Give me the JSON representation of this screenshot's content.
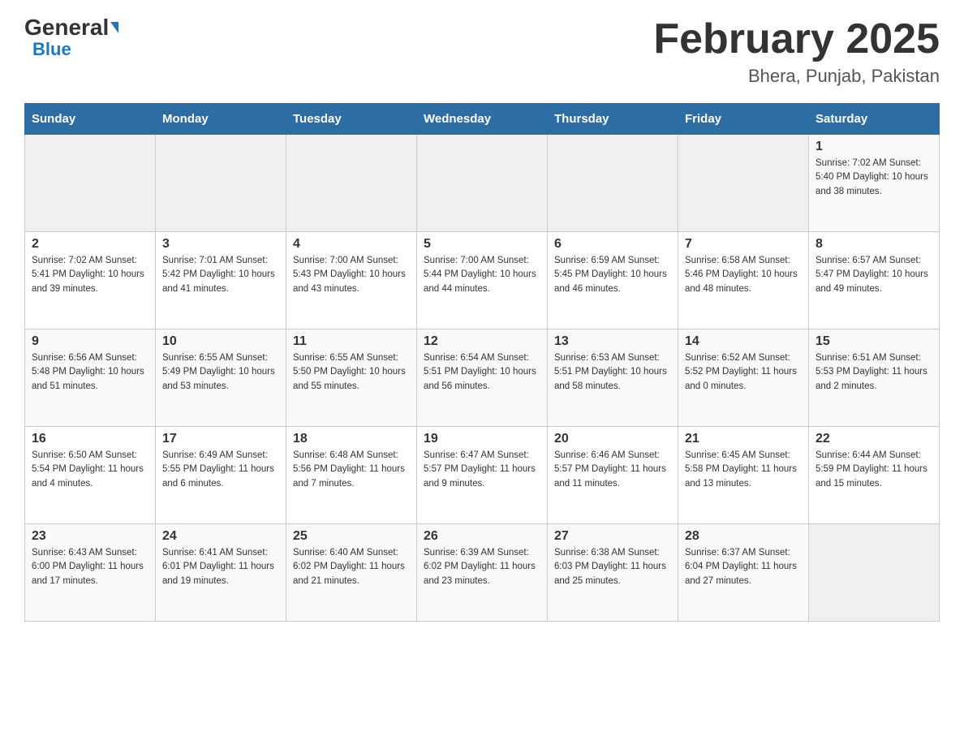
{
  "header": {
    "logo_general": "General",
    "logo_blue": "Blue",
    "month_title": "February 2025",
    "location": "Bhera, Punjab, Pakistan"
  },
  "weekdays": [
    "Sunday",
    "Monday",
    "Tuesday",
    "Wednesday",
    "Thursday",
    "Friday",
    "Saturday"
  ],
  "weeks": [
    [
      {
        "day": "",
        "info": ""
      },
      {
        "day": "",
        "info": ""
      },
      {
        "day": "",
        "info": ""
      },
      {
        "day": "",
        "info": ""
      },
      {
        "day": "",
        "info": ""
      },
      {
        "day": "",
        "info": ""
      },
      {
        "day": "1",
        "info": "Sunrise: 7:02 AM\nSunset: 5:40 PM\nDaylight: 10 hours\nand 38 minutes."
      }
    ],
    [
      {
        "day": "2",
        "info": "Sunrise: 7:02 AM\nSunset: 5:41 PM\nDaylight: 10 hours\nand 39 minutes."
      },
      {
        "day": "3",
        "info": "Sunrise: 7:01 AM\nSunset: 5:42 PM\nDaylight: 10 hours\nand 41 minutes."
      },
      {
        "day": "4",
        "info": "Sunrise: 7:00 AM\nSunset: 5:43 PM\nDaylight: 10 hours\nand 43 minutes."
      },
      {
        "day": "5",
        "info": "Sunrise: 7:00 AM\nSunset: 5:44 PM\nDaylight: 10 hours\nand 44 minutes."
      },
      {
        "day": "6",
        "info": "Sunrise: 6:59 AM\nSunset: 5:45 PM\nDaylight: 10 hours\nand 46 minutes."
      },
      {
        "day": "7",
        "info": "Sunrise: 6:58 AM\nSunset: 5:46 PM\nDaylight: 10 hours\nand 48 minutes."
      },
      {
        "day": "8",
        "info": "Sunrise: 6:57 AM\nSunset: 5:47 PM\nDaylight: 10 hours\nand 49 minutes."
      }
    ],
    [
      {
        "day": "9",
        "info": "Sunrise: 6:56 AM\nSunset: 5:48 PM\nDaylight: 10 hours\nand 51 minutes."
      },
      {
        "day": "10",
        "info": "Sunrise: 6:55 AM\nSunset: 5:49 PM\nDaylight: 10 hours\nand 53 minutes."
      },
      {
        "day": "11",
        "info": "Sunrise: 6:55 AM\nSunset: 5:50 PM\nDaylight: 10 hours\nand 55 minutes."
      },
      {
        "day": "12",
        "info": "Sunrise: 6:54 AM\nSunset: 5:51 PM\nDaylight: 10 hours\nand 56 minutes."
      },
      {
        "day": "13",
        "info": "Sunrise: 6:53 AM\nSunset: 5:51 PM\nDaylight: 10 hours\nand 58 minutes."
      },
      {
        "day": "14",
        "info": "Sunrise: 6:52 AM\nSunset: 5:52 PM\nDaylight: 11 hours\nand 0 minutes."
      },
      {
        "day": "15",
        "info": "Sunrise: 6:51 AM\nSunset: 5:53 PM\nDaylight: 11 hours\nand 2 minutes."
      }
    ],
    [
      {
        "day": "16",
        "info": "Sunrise: 6:50 AM\nSunset: 5:54 PM\nDaylight: 11 hours\nand 4 minutes."
      },
      {
        "day": "17",
        "info": "Sunrise: 6:49 AM\nSunset: 5:55 PM\nDaylight: 11 hours\nand 6 minutes."
      },
      {
        "day": "18",
        "info": "Sunrise: 6:48 AM\nSunset: 5:56 PM\nDaylight: 11 hours\nand 7 minutes."
      },
      {
        "day": "19",
        "info": "Sunrise: 6:47 AM\nSunset: 5:57 PM\nDaylight: 11 hours\nand 9 minutes."
      },
      {
        "day": "20",
        "info": "Sunrise: 6:46 AM\nSunset: 5:57 PM\nDaylight: 11 hours\nand 11 minutes."
      },
      {
        "day": "21",
        "info": "Sunrise: 6:45 AM\nSunset: 5:58 PM\nDaylight: 11 hours\nand 13 minutes."
      },
      {
        "day": "22",
        "info": "Sunrise: 6:44 AM\nSunset: 5:59 PM\nDaylight: 11 hours\nand 15 minutes."
      }
    ],
    [
      {
        "day": "23",
        "info": "Sunrise: 6:43 AM\nSunset: 6:00 PM\nDaylight: 11 hours\nand 17 minutes."
      },
      {
        "day": "24",
        "info": "Sunrise: 6:41 AM\nSunset: 6:01 PM\nDaylight: 11 hours\nand 19 minutes."
      },
      {
        "day": "25",
        "info": "Sunrise: 6:40 AM\nSunset: 6:02 PM\nDaylight: 11 hours\nand 21 minutes."
      },
      {
        "day": "26",
        "info": "Sunrise: 6:39 AM\nSunset: 6:02 PM\nDaylight: 11 hours\nand 23 minutes."
      },
      {
        "day": "27",
        "info": "Sunrise: 6:38 AM\nSunset: 6:03 PM\nDaylight: 11 hours\nand 25 minutes."
      },
      {
        "day": "28",
        "info": "Sunrise: 6:37 AM\nSunset: 6:04 PM\nDaylight: 11 hours\nand 27 minutes."
      },
      {
        "day": "",
        "info": ""
      }
    ]
  ]
}
